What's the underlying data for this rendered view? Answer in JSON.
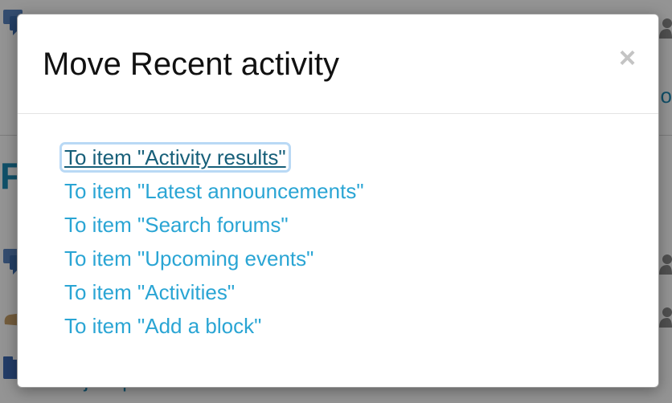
{
  "background": {
    "heading_fragment": "F",
    "link_fragment": "o",
    "footer_text": "Project presentations",
    "icons": [
      "forum-icon",
      "forum-icon",
      "user-icon",
      "hand-icon",
      "folder-icon"
    ]
  },
  "modal": {
    "title": "Move Recent activity",
    "close_label": "×",
    "targets": [
      {
        "label": "To item \"Activity results\"",
        "focused": true
      },
      {
        "label": "To item \"Latest announcements\"",
        "focused": false
      },
      {
        "label": "To item \"Search forums\"",
        "focused": false
      },
      {
        "label": "To item \"Upcoming events\"",
        "focused": false
      },
      {
        "label": "To item \"Activities\"",
        "focused": false
      },
      {
        "label": "To item \"Add a block\"",
        "focused": false
      }
    ]
  },
  "colors": {
    "link": "#2aa5d4",
    "link_focused": "#175f79",
    "focus_ring": "#b9d9f5",
    "backdrop": "rgba(0,0,0,0.42)"
  }
}
